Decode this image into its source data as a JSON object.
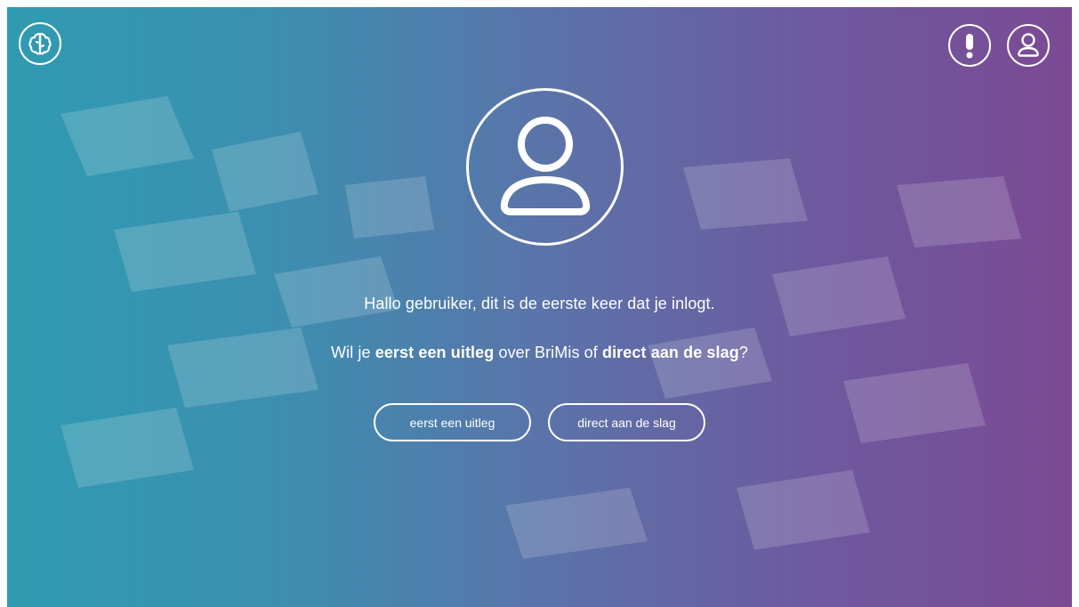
{
  "header": {
    "logo_icon": "brain-icon",
    "alert_icon": "exclamation-icon",
    "profile_icon": "user-icon"
  },
  "welcome": {
    "avatar_icon": "user-icon",
    "greeting": "Hallo gebruiker, dit is de eerste keer dat je inlogt.",
    "question": {
      "prefix": "Wil je ",
      "option1": "eerst een uitleg",
      "middle": " over BriMis of ",
      "option2": "direct aan de slag",
      "suffix": "?"
    }
  },
  "actions": {
    "explain_label": "eerst een uitleg",
    "start_label": "direct aan de slag"
  },
  "colors": {
    "gradient_left": "#2f9bb1",
    "gradient_right": "#7b4a94",
    "foreground": "#ffffff"
  }
}
